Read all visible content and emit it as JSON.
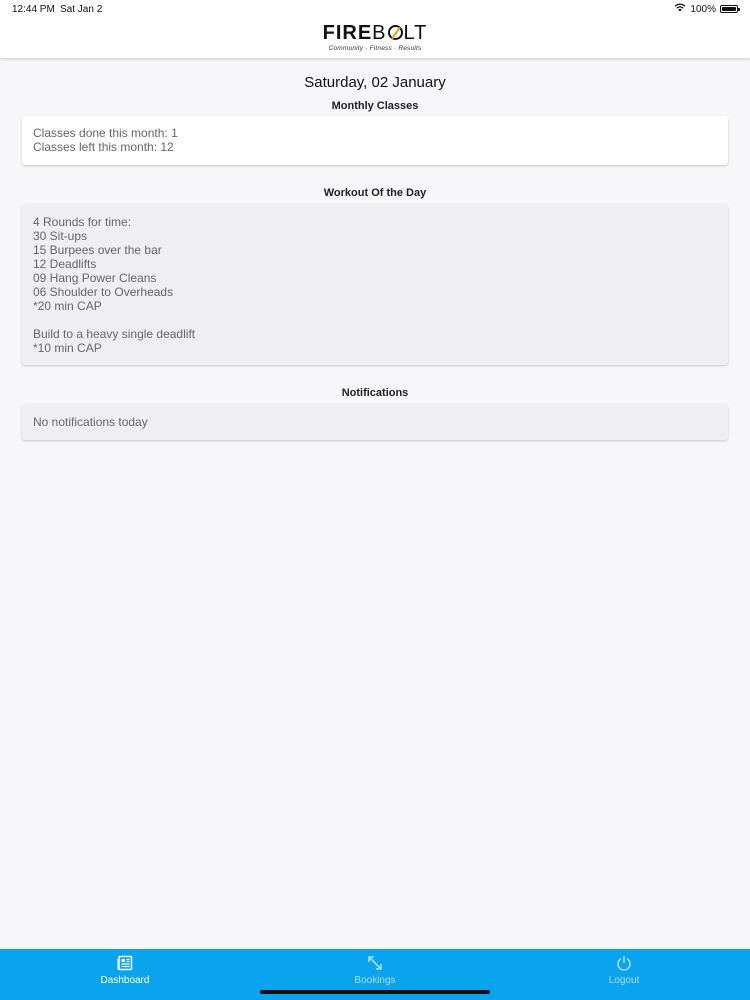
{
  "status_bar": {
    "time": "12:44 PM",
    "date": "Sat Jan 2",
    "battery": "100%"
  },
  "header": {
    "logo_fire": "FIRE",
    "logo_b": "B",
    "logo_lt": "LT",
    "tagline": "Community · Fitness · Results"
  },
  "main": {
    "date": "Saturday, 02 January",
    "monthly": {
      "title": "Monthly Classes",
      "done": "Classes done this month: 1",
      "left": "Classes left this month: 12"
    },
    "wod": {
      "title": "Workout Of the Day",
      "text": "4 Rounds for time:\n30 Sit-ups\n15 Burpees over the bar\n12 Deadlifts\n09 Hang Power Cleans\n06 Shoulder to Overheads\n*20 min CAP\n\nBuild to a heavy single deadlift\n*10 min CAP"
    },
    "notifications": {
      "title": "Notifications",
      "text": "No notifications today"
    }
  },
  "bottom_nav": {
    "items": [
      {
        "label": "Dashboard",
        "icon": "newspaper-icon",
        "active": true
      },
      {
        "label": "Bookings",
        "icon": "expand-arrows-icon",
        "active": false
      },
      {
        "label": "Logout",
        "icon": "power-icon",
        "active": false
      }
    ]
  },
  "colors": {
    "nav_bg": "#0aa4ee",
    "accent": "#e5a21a",
    "page_bg": "#f7f6f9"
  }
}
